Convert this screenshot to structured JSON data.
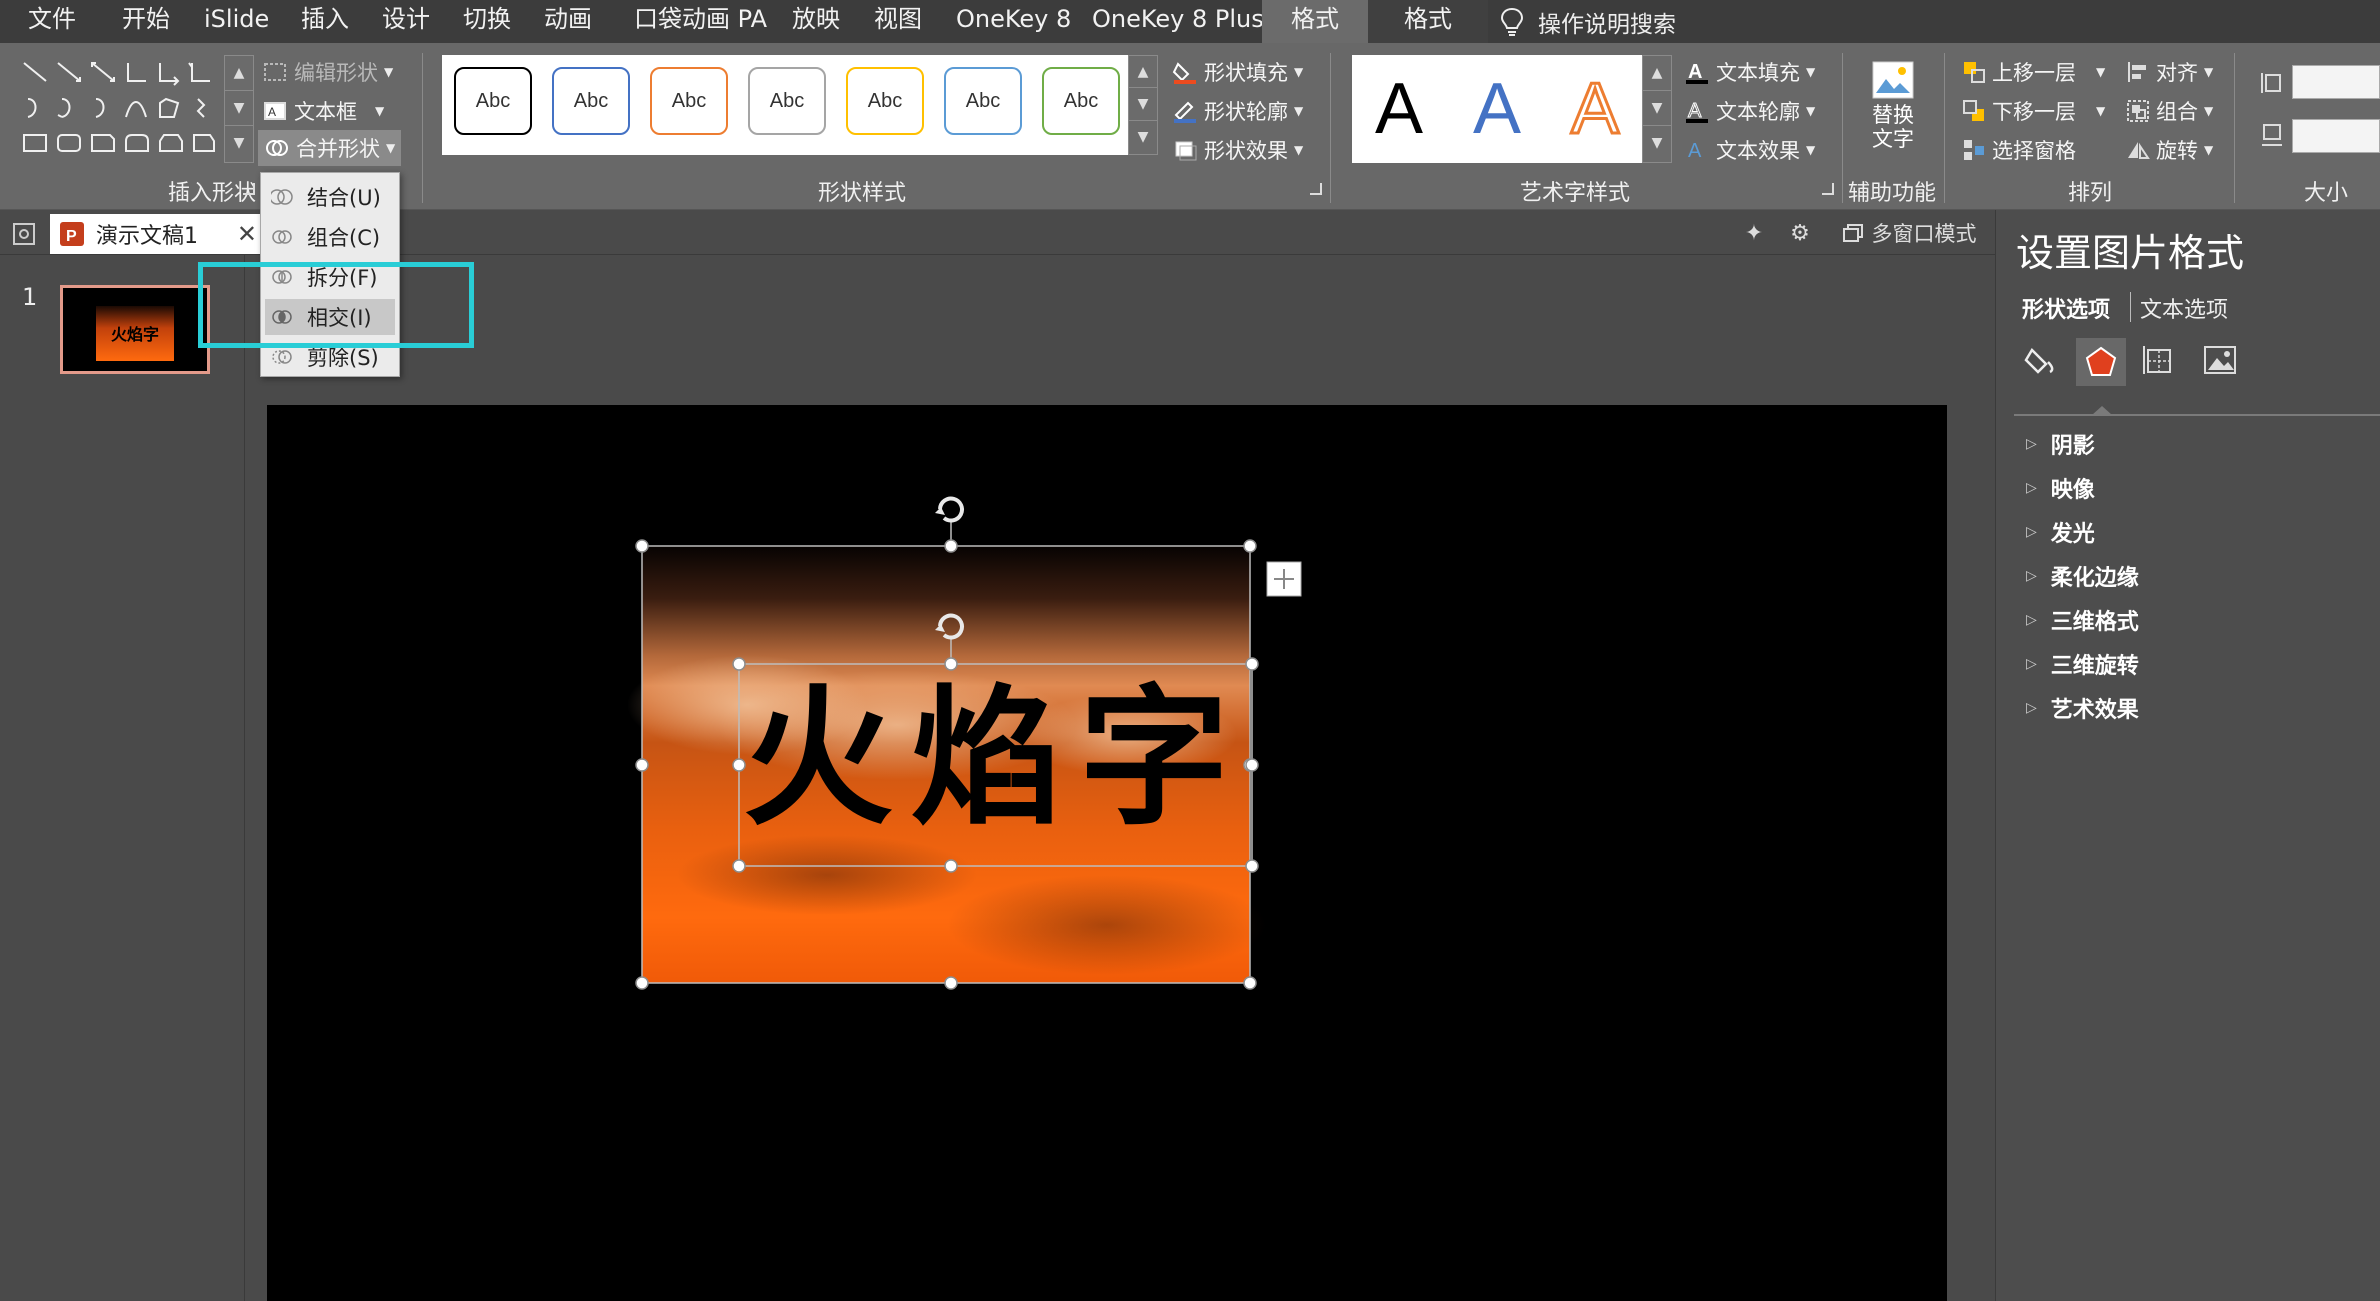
{
  "menubar": {
    "items": [
      "文件",
      "开始",
      "iSlide",
      "插入",
      "设计",
      "切换",
      "动画",
      "口袋动画 PA",
      "放映",
      "视图",
      "OneKey 8",
      "OneKey 8 Plus",
      "格式",
      "格式"
    ],
    "search_label": "操作说明搜索"
  },
  "ribbon": {
    "insert_shapes": {
      "label": "插入形状",
      "edit_shape": "编辑形状",
      "text_box": "文本框",
      "merge_shapes": "合并形状"
    },
    "shape_styles": {
      "label": "形状样式",
      "thumb_text": "Abc",
      "thumb_colors": [
        "#000000",
        "#4472c4",
        "#ed7d31",
        "#a5a5a5",
        "#ffc000",
        "#5b9bd5",
        "#70ad47"
      ],
      "shape_fill": "形状填充",
      "shape_outline": "形状轮廓",
      "shape_effects": "形状效果"
    },
    "wordart_styles": {
      "label": "艺术字样式",
      "thumb_text": "A",
      "thumb_colors": [
        "#000000",
        "#4472c4",
        "#ed7d31"
      ],
      "text_fill": "文本填充",
      "text_outline": "文本轮廓",
      "text_effects": "文本效果"
    },
    "accessibility": {
      "label": "辅助功能",
      "alt_text_line1": "替换",
      "alt_text_line2": "文字"
    },
    "arrange": {
      "label": "排列",
      "bring_forward": "上移一层",
      "send_backward": "下移一层",
      "selection_pane": "选择窗格",
      "align": "对齐",
      "group": "组合",
      "rotate": "旋转"
    },
    "size": {
      "label": "大小"
    }
  },
  "merge_menu": {
    "items": [
      "结合(U)",
      "组合(C)",
      "拆分(F)",
      "相交(I)",
      "剪除(S)"
    ],
    "highlighted": "相交(I)",
    "highlight_color": "#29cdd6"
  },
  "tabstrip": {
    "doc_name": "演示文稿1",
    "multi_window": "多窗口模式"
  },
  "slides": {
    "number": "1"
  },
  "slide": {
    "title_text": "火焰字",
    "fire_colors": [
      "#ff6a0e",
      "#c2410c",
      "#000000"
    ]
  },
  "format_pane": {
    "title": "设置图片格式",
    "tabs": [
      "形状选项",
      "文本选项"
    ],
    "sections": [
      "阴影",
      "映像",
      "发光",
      "柔化边缘",
      "三维格式",
      "三维旋转",
      "艺术效果"
    ]
  }
}
